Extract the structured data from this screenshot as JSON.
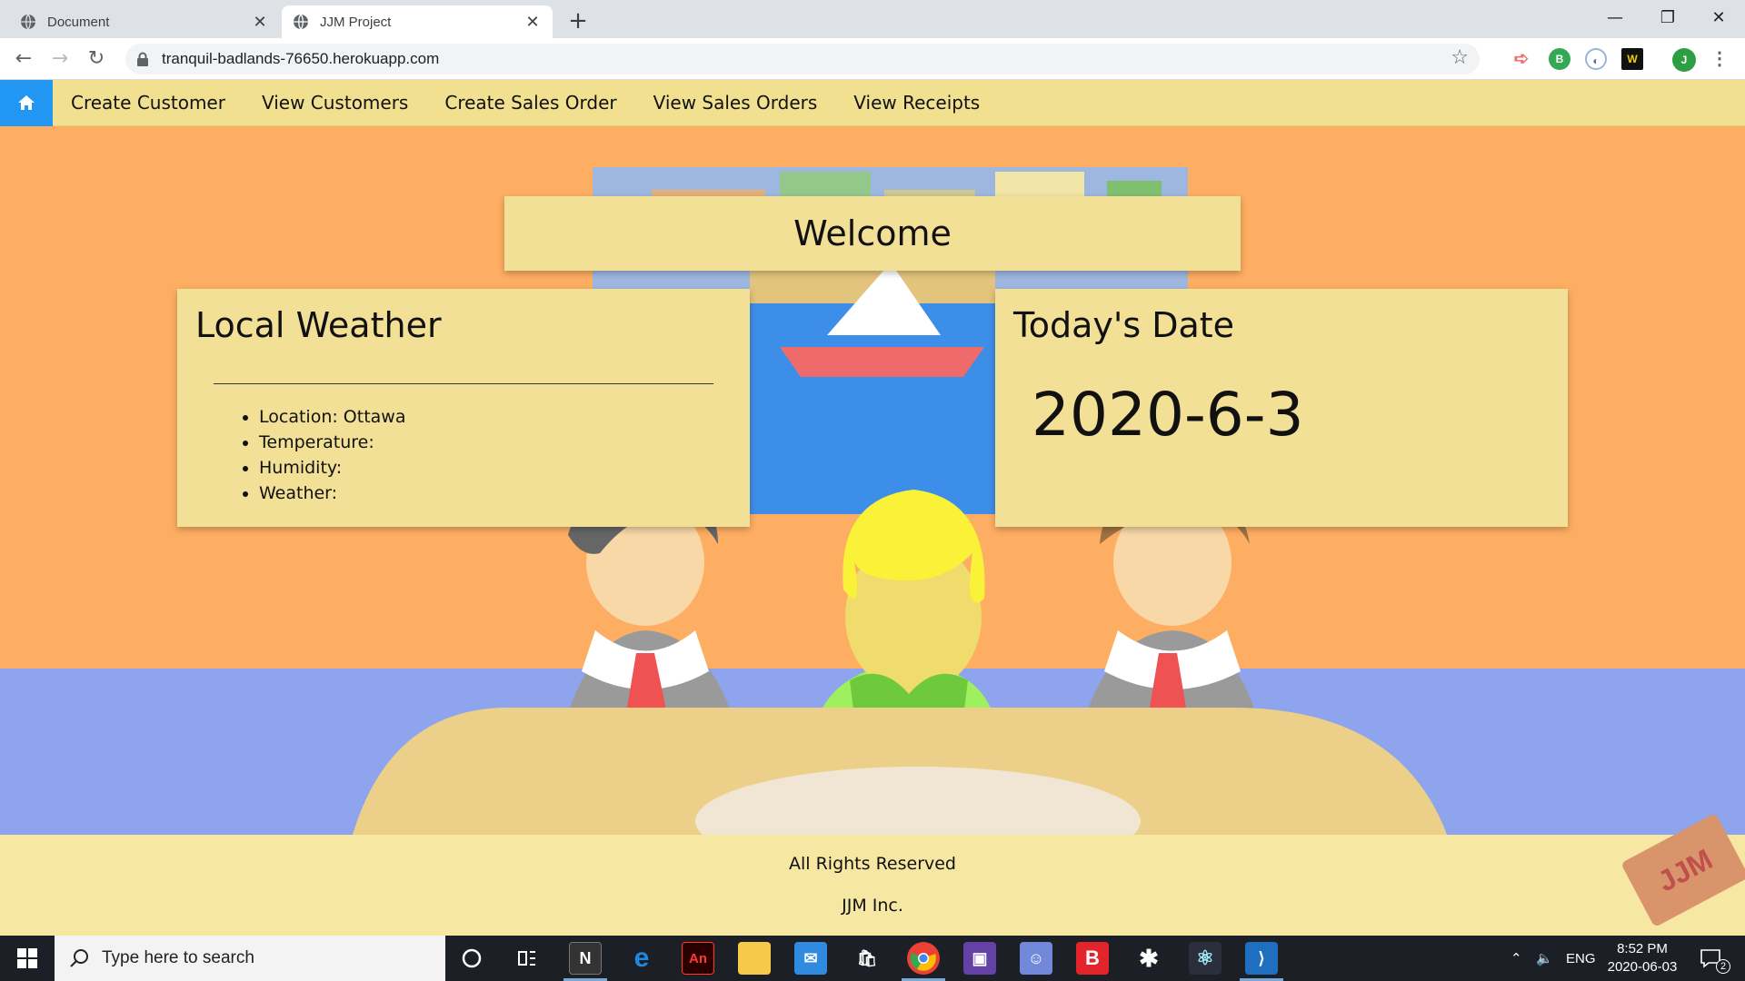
{
  "browser": {
    "tabs": [
      {
        "title": "Document",
        "active": false
      },
      {
        "title": "JJM Project",
        "active": true
      }
    ],
    "url": "tranquil-badlands-76650.herokuapp.com",
    "profile_initial": "J",
    "extension_b": "B"
  },
  "site": {
    "nav": {
      "links": [
        "Create Customer",
        "View Customers",
        "Create Sales Order",
        "View Sales Orders",
        "View Receipts"
      ]
    },
    "welcome": "Welcome",
    "weather": {
      "title": "Local Weather",
      "items": [
        "Location: Ottawa",
        "Temperature:",
        "Humidity:",
        "Weather:"
      ]
    },
    "date": {
      "title": "Today's Date",
      "value": "2020-6-3"
    },
    "footer": {
      "line1": "All Rights Reserved",
      "line2": "JJM Inc.",
      "badge": "JJM"
    },
    "colors": {
      "accent": "#2196f3",
      "navbar": "#f1e08f",
      "background": "#fdae62",
      "card": "#f1e095"
    }
  },
  "taskbar": {
    "search_placeholder": "Type here to search",
    "time": "8:52 PM",
    "date": "2020-06-03",
    "language": "ENG",
    "notifications": "2",
    "apps": [
      "cortana-icon",
      "task-view-icon",
      "notion-icon",
      "edge-icon",
      "animate-icon",
      "file-explorer-icon",
      "mail-icon",
      "store-icon",
      "chrome-icon",
      "twitch-icon",
      "discord-icon",
      "bitdefender-icon",
      "slack-icon",
      "electron-icon",
      "vscode-icon"
    ]
  }
}
